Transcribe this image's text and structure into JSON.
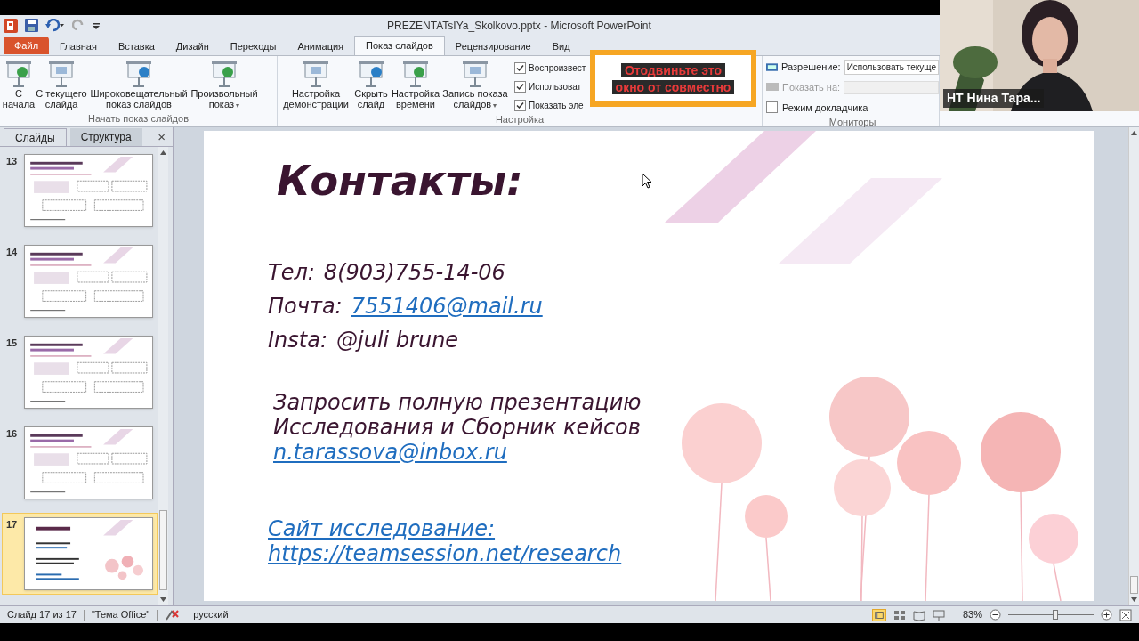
{
  "window": {
    "title": "PREZENTATsIYa_Skolkovo.pptx - Microsoft PowerPoint"
  },
  "tabs": [
    {
      "label": "Файл",
      "selected": false,
      "kind": "file"
    },
    {
      "label": "Главная",
      "selected": false,
      "kind": "tab"
    },
    {
      "label": "Вставка",
      "selected": false,
      "kind": "tab"
    },
    {
      "label": "Дизайн",
      "selected": false,
      "kind": "tab"
    },
    {
      "label": "Переходы",
      "selected": false,
      "kind": "tab"
    },
    {
      "label": "Анимация",
      "selected": false,
      "kind": "tab"
    },
    {
      "label": "Показ слайдов",
      "selected": true,
      "kind": "tab"
    },
    {
      "label": "Рецензирование",
      "selected": false,
      "kind": "tab"
    },
    {
      "label": "Вид",
      "selected": false,
      "kind": "tab"
    }
  ],
  "ribbon": {
    "groups": [
      {
        "label": "Начать показ слайдов",
        "buttons": [
          {
            "label": "С начала"
          },
          {
            "label": "С текущего слайда"
          },
          {
            "label": "Широковещательный показ слайдов"
          },
          {
            "label": "Произвольный показ",
            "arrow": "▾"
          }
        ]
      },
      {
        "label": "Настройка",
        "buttons": [
          {
            "label": "Настройка демонстрации"
          },
          {
            "label": "Скрыть слайд"
          },
          {
            "label": "Настройка времени"
          },
          {
            "label": "Запись показа слайдов",
            "arrow": "▾"
          }
        ],
        "checkboxes": [
          {
            "label": "Воспроизвест",
            "checked": true
          },
          {
            "label": "Использоват",
            "checked": true
          },
          {
            "label": "Показать эле",
            "checked": true
          }
        ]
      },
      {
        "label": "Мониторы",
        "resolution_label": "Разрешение:",
        "resolution_value": "Использовать текуще",
        "show_on_label": "Показать на:",
        "presenter_mode": {
          "label": "Режим докладчика",
          "checked": false
        }
      }
    ]
  },
  "share_notice": {
    "lines": [
      "Отодвиньте это",
      "окно от совместно"
    ]
  },
  "video_tile": {
    "name": "НТ Нина Тара..."
  },
  "slides_panel": {
    "tabs": [
      {
        "label": "Слайды",
        "selected": true
      },
      {
        "label": "Структура",
        "selected": false
      }
    ],
    "close": "×",
    "thumbnails": [
      {
        "number": "13",
        "selected": false
      },
      {
        "number": "14",
        "selected": false
      },
      {
        "number": "15",
        "selected": false
      },
      {
        "number": "16",
        "selected": false
      },
      {
        "number": "17",
        "selected": true
      }
    ]
  },
  "slide": {
    "title": "Контакты:",
    "contacts": [
      {
        "kind": "text",
        "label": "Тел:",
        "value": "8(903)755-14-06"
      },
      {
        "kind": "link",
        "label": "Почта:",
        "value": "7551406@mail.ru"
      },
      {
        "kind": "text",
        "label": "Insta:",
        "value": "@juli brune"
      }
    ],
    "request_lines": [
      "Запросить полную презентацию",
      "Исследования и Сборник кейсов"
    ],
    "request_email": "n.tarassova@inbox.ru",
    "site_label": "Сайт исследование:",
    "site_url": "https://teamsession.net/research"
  },
  "status_bar": {
    "slide": "Слайд 17 из 17",
    "theme": "\"Тема Office\"",
    "language": "русский",
    "zoom": "83%",
    "zoom_level": {
      "level": 0.55
    }
  }
}
